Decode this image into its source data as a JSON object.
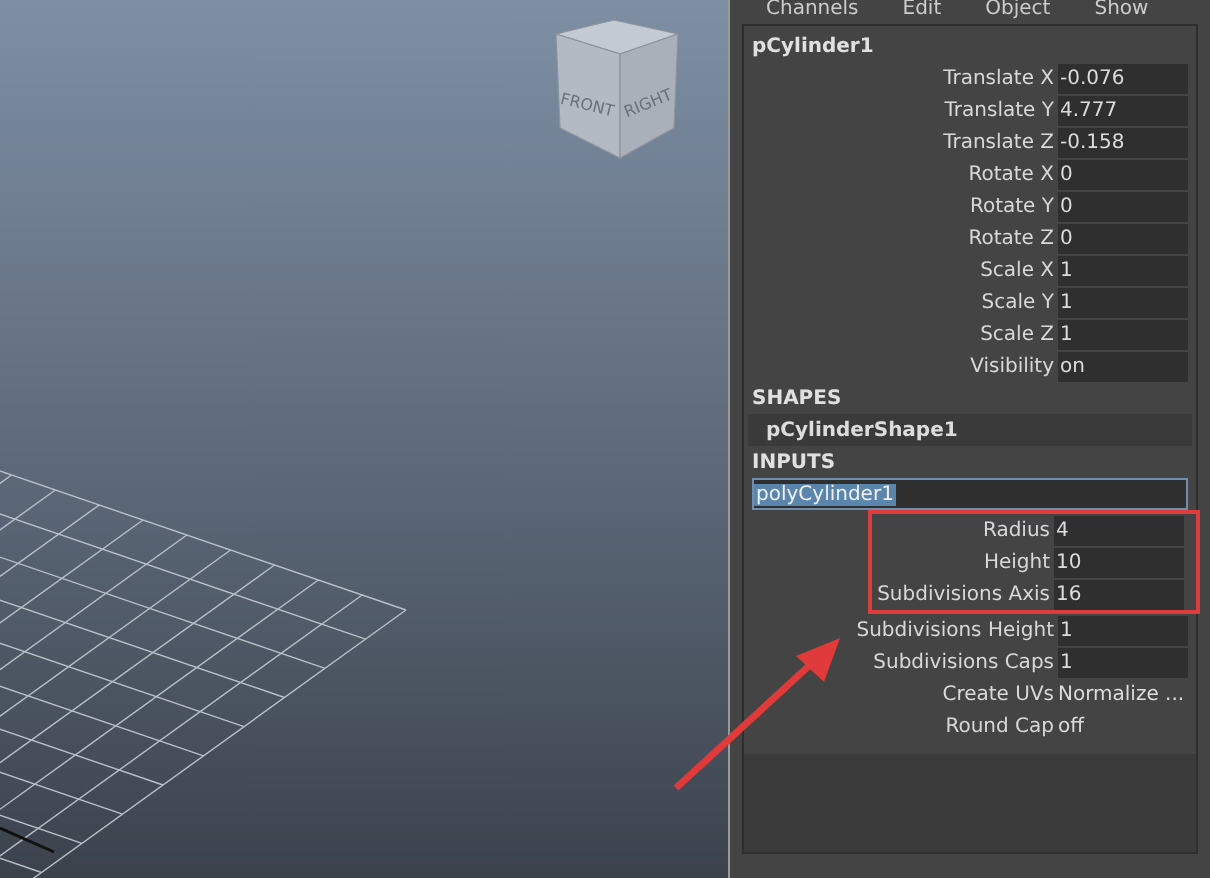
{
  "menu": [
    "Channels",
    "Edit",
    "Object",
    "Show"
  ],
  "viewcube": {
    "faces": [
      "FRONT",
      "RIGHT"
    ]
  },
  "object": {
    "name": "pCylinder1",
    "attributes": [
      {
        "label": "Translate X",
        "value": "-0.076"
      },
      {
        "label": "Translate Y",
        "value": "4.777"
      },
      {
        "label": "Translate Z",
        "value": "-0.158"
      },
      {
        "label": "Rotate X",
        "value": "0"
      },
      {
        "label": "Rotate Y",
        "value": "0"
      },
      {
        "label": "Rotate Z",
        "value": "0"
      },
      {
        "label": "Scale X",
        "value": "1"
      },
      {
        "label": "Scale Y",
        "value": "1"
      },
      {
        "label": "Scale Z",
        "value": "1"
      },
      {
        "label": "Visibility",
        "value": "on"
      }
    ]
  },
  "shapes": {
    "heading": "SHAPES",
    "items": [
      "pCylinderShape1"
    ]
  },
  "inputs": {
    "heading": "INPUTS",
    "node": {
      "name": "polyCylinder1",
      "selected": true
    },
    "attributes": [
      {
        "label": "Radius",
        "value": "4",
        "kind": "field",
        "highlighted": true
      },
      {
        "label": "Height",
        "value": "10",
        "kind": "field",
        "highlighted": true
      },
      {
        "label": "Subdivisions Axis",
        "value": "16",
        "kind": "field",
        "highlighted": true
      },
      {
        "label": "Subdivisions Height",
        "value": "1",
        "kind": "field",
        "highlighted": false
      },
      {
        "label": "Subdivisions Caps",
        "value": "1",
        "kind": "field",
        "highlighted": false
      },
      {
        "label": "Create UVs",
        "value": "Normalize ...",
        "kind": "text",
        "highlighted": false
      },
      {
        "label": "Round Cap",
        "value": "off",
        "kind": "text",
        "highlighted": false
      }
    ]
  }
}
